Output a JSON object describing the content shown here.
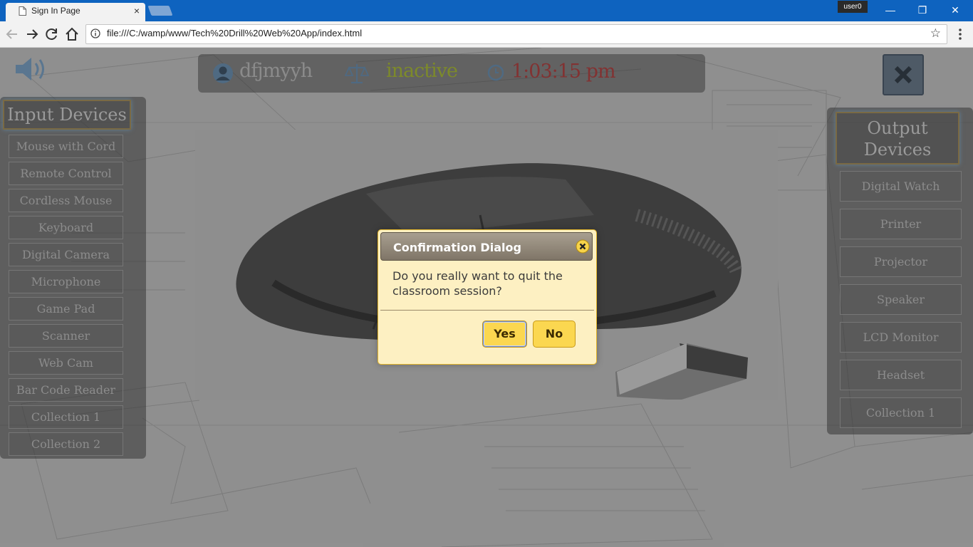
{
  "browser": {
    "tab_title": "Sign In Page",
    "tab_close": "×",
    "user_badge": "user0",
    "window_controls": {
      "minimize": "—",
      "maximize": "❐",
      "close": "✕"
    },
    "url": "file:///C:/wamp/www/Tech%20Drill%20Web%20App/index.html",
    "bookmark_star": "☆"
  },
  "status": {
    "username": "dfjmyyh",
    "state": "inactive",
    "time": "1:03:15 pm"
  },
  "input_panel": {
    "heading": "Input Devices",
    "items": [
      "Mouse with Cord",
      "Remote Control",
      "Cordless Mouse",
      "Keyboard",
      "Digital Camera",
      "Microphone",
      "Game Pad",
      "Scanner",
      "Web Cam",
      "Bar Code Reader",
      "Collection 1",
      "Collection 2"
    ]
  },
  "output_panel": {
    "heading": "Output Devices",
    "items": [
      "Digital Watch",
      "Printer",
      "Projector",
      "Speaker",
      "LCD Monitor",
      "Headset",
      "Collection 1"
    ]
  },
  "dialog": {
    "title": "Confirmation Dialog",
    "message": "Do you really want to quit the classroom session?",
    "yes_label": "Yes",
    "no_label": "No"
  },
  "colors": {
    "titlebar": "#0e63bf",
    "dialog_bg": "#fdf0c2",
    "dialog_button": "#fbd750",
    "dialog_header": "#8a8071"
  }
}
